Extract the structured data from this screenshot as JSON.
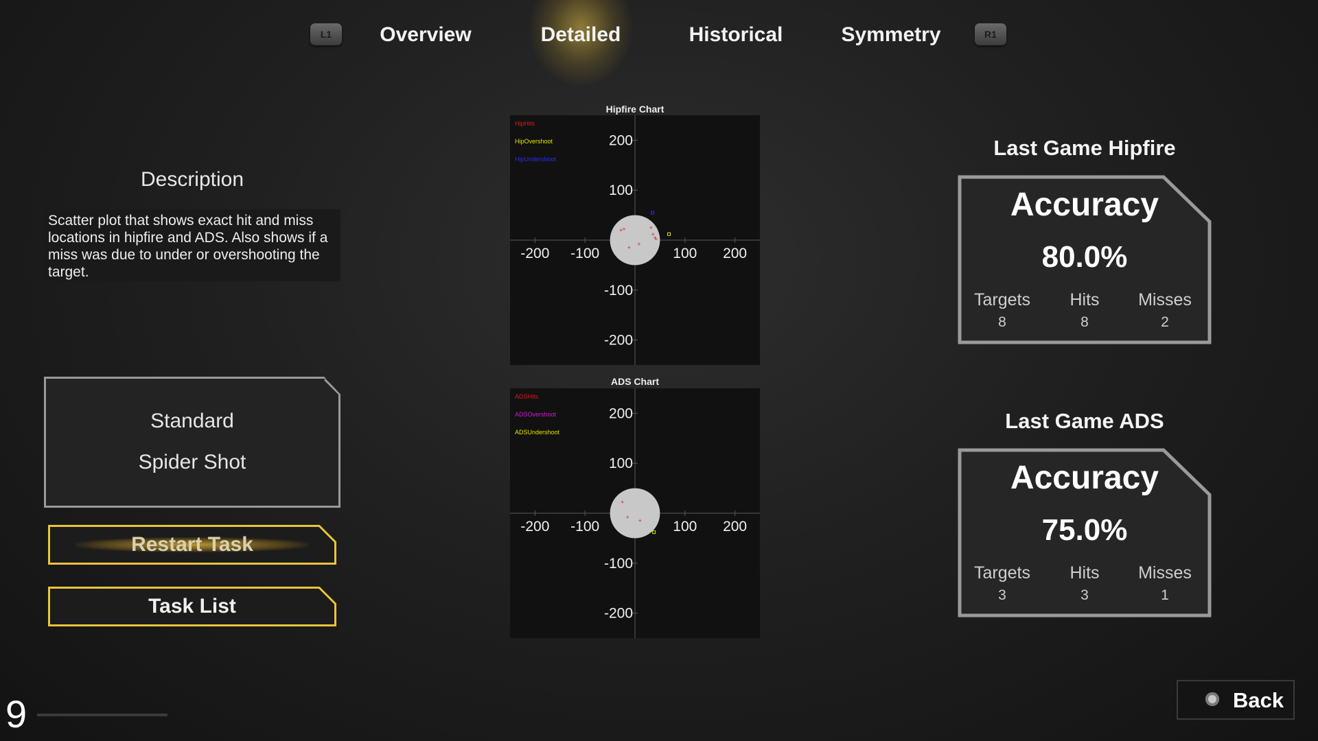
{
  "tabs": {
    "left_bumper": "L1",
    "right_bumper": "R1",
    "items": [
      {
        "label": "Overview"
      },
      {
        "label": "Detailed"
      },
      {
        "label": "Historical"
      },
      {
        "label": "Symmetry"
      }
    ],
    "active": "Detailed"
  },
  "description": {
    "title": "Description",
    "text": "Scatter plot that shows exact hit and miss locations in hipfire and ADS. Also shows if a miss was due to under or overshooting the target."
  },
  "task": {
    "line1": "Standard",
    "line2": "Spider Shot",
    "restart_label": "Restart Task",
    "tasklist_label": "Task List"
  },
  "chart_data": [
    {
      "type": "scatter",
      "title": "Hipfire Chart",
      "xlim": [
        -250,
        250
      ],
      "ylim": [
        -250,
        250
      ],
      "x_ticks": [
        -200,
        -100,
        100,
        200
      ],
      "y_ticks": [
        200,
        100,
        -100,
        -200
      ],
      "target_radius": 50,
      "legend": [
        "HipHits",
        "HipOvershoot",
        "HipUndershoot"
      ],
      "legend_colors": [
        "#e01a1a",
        "#e6e600",
        "#2a2aff"
      ],
      "series": [
        {
          "name": "HipHits",
          "color": "#e01a1a",
          "points": [
            [
              -28,
              20
            ],
            [
              -22,
              22
            ],
            [
              32,
              25
            ],
            [
              40,
              5
            ],
            [
              42,
              2
            ],
            [
              -12,
              -15
            ],
            [
              8,
              -8
            ],
            [
              36,
              12
            ]
          ]
        },
        {
          "name": "HipOvershoot",
          "color": "#e6e600",
          "points": [
            [
              68,
              12
            ]
          ]
        },
        {
          "name": "HipUndershoot",
          "color": "#2a2aff",
          "points": [
            [
              35,
              55
            ]
          ]
        }
      ]
    },
    {
      "type": "scatter",
      "title": "ADS Chart",
      "xlim": [
        -250,
        250
      ],
      "ylim": [
        -250,
        250
      ],
      "x_ticks": [
        -200,
        -100,
        100,
        200
      ],
      "y_ticks": [
        200,
        100,
        -100,
        -200
      ],
      "target_radius": 50,
      "legend": [
        "ADSHits",
        "ADSOvershoot",
        "ADSUndershoot"
      ],
      "legend_colors": [
        "#e01a1a",
        "#d61ad6",
        "#e6e600"
      ],
      "series": [
        {
          "name": "ADSHits",
          "color": "#e01a1a",
          "points": [
            [
              -25,
              22
            ],
            [
              -15,
              -8
            ],
            [
              10,
              -15
            ]
          ]
        },
        {
          "name": "ADSUndershoot",
          "color": "#e6e600",
          "points": [
            [
              38,
              -38
            ]
          ]
        }
      ]
    }
  ],
  "hipfire": {
    "heading": "Last Game Hipfire",
    "accuracy_label": "Accuracy",
    "accuracy": "80.0%",
    "targets_label": "Targets",
    "targets": "8",
    "hits_label": "Hits",
    "hits": "8",
    "misses_label": "Misses",
    "misses": "2"
  },
  "ads": {
    "heading": "Last Game ADS",
    "accuracy_label": "Accuracy",
    "accuracy": "75.0%",
    "targets_label": "Targets",
    "targets": "3",
    "hits_label": "Hits",
    "hits": "3",
    "misses_label": "Misses",
    "misses": "1"
  },
  "footer": {
    "page_number": "9",
    "back_label": "Back",
    "back_icon": "circle-button-icon"
  }
}
